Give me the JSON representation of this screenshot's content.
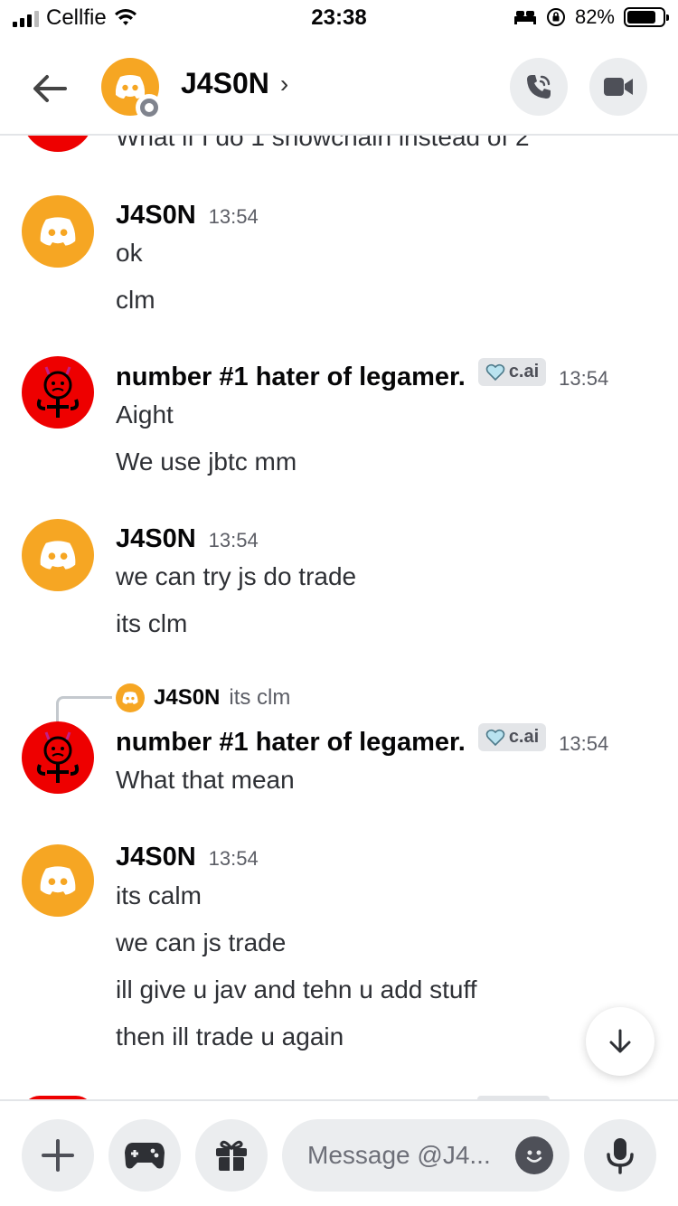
{
  "status_bar": {
    "carrier": "Cellfie",
    "time": "23:38",
    "battery_percent": "82%",
    "battery_level": 0.82
  },
  "header": {
    "title": "J4S0N",
    "chevron": "›",
    "icons": [
      "back-arrow-icon",
      "discord-logo-icon",
      "phone-call-icon",
      "video-camera-icon"
    ]
  },
  "partial_message": "What if I do 1 showchain instead of 2",
  "messages": [
    {
      "author": "J4S0N",
      "time": "13:54",
      "lines": [
        "ok",
        "clm"
      ]
    },
    {
      "author": "number #1 hater of legamer.",
      "tag": "c.ai",
      "time": "13:54",
      "lines": [
        "Aight",
        "We use jbtc mm"
      ]
    },
    {
      "author": "J4S0N",
      "time": "13:54",
      "lines": [
        "we can try js do trade",
        "its clm"
      ]
    },
    {
      "author": "number #1 hater of legamer.",
      "tag": "c.ai",
      "time": "13:54",
      "reply_author": "J4S0N",
      "reply_text": "its clm",
      "lines": [
        "What that mean"
      ]
    },
    {
      "author": "J4S0N",
      "time": "13:54",
      "lines": [
        "its calm",
        "we can js trade",
        "ill give u jav and tehn u add stuff",
        "then ill trade u again"
      ]
    }
  ],
  "composer": {
    "placeholder": "Message @J4...",
    "icons": [
      "plus-icon",
      "gamepad-icon",
      "gift-icon",
      "emoji-icon",
      "microphone-icon"
    ]
  },
  "colors": {
    "discord_avatar": "#f6a623",
    "red_avatar": "#ee0000",
    "tag_bg": "#e3e5e8",
    "button_bg": "#ebedef"
  }
}
